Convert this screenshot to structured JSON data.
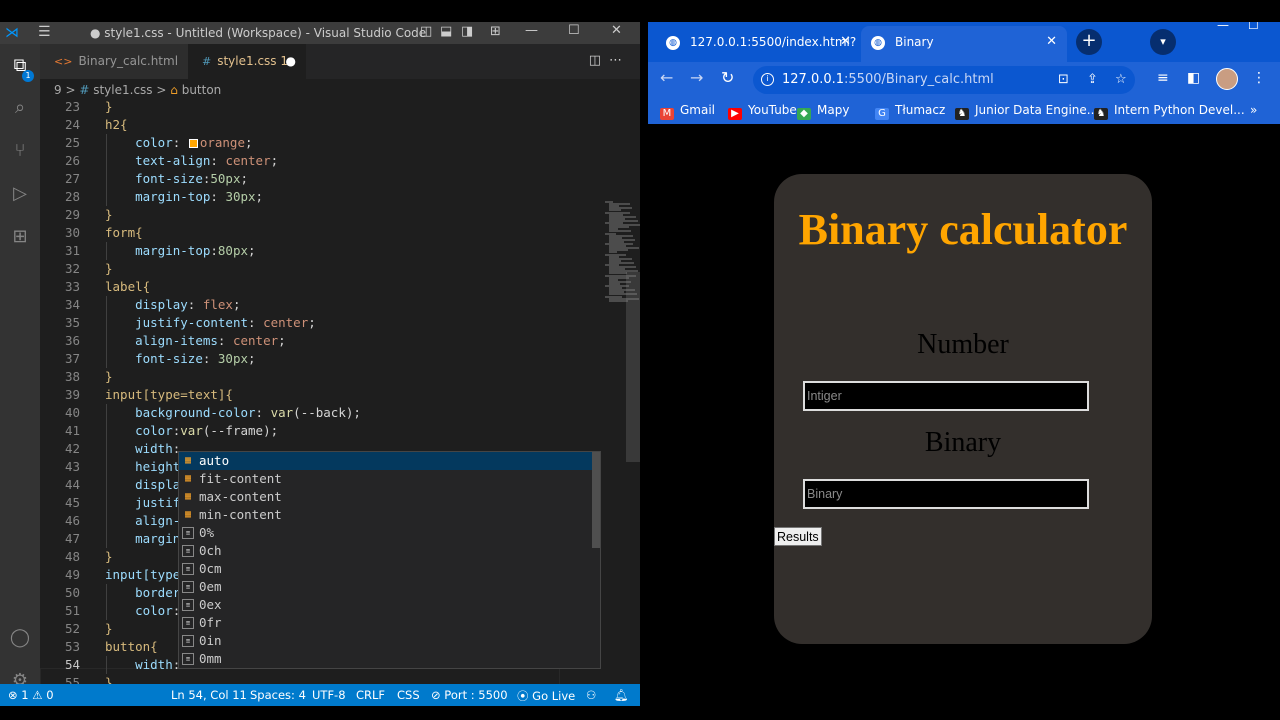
{
  "vscode": {
    "title": "● style1.css - Untitled (Workspace) - Visual Studio Code",
    "tabs": [
      {
        "label": "Binary_calc.html"
      },
      {
        "label": "style1.css 1"
      }
    ],
    "breadcrumb": {
      "prefix": "9 >",
      "file": "style1.css",
      "symbol": "button"
    },
    "status": {
      "problems": "⊗ 1 ⚠ 0",
      "position": "Ln 54, Col 11",
      "spaces": "Spaces: 4",
      "encoding": "UTF-8",
      "eol": "CRLF",
      "language": "CSS",
      "port": "⊘ Port : 5500",
      "golive": "⦿ Go Live"
    },
    "lines": [
      {
        "n": "23",
        "code": "}"
      },
      {
        "n": "24",
        "code": "h2{"
      },
      {
        "n": "25",
        "code": "    color: orange;"
      },
      {
        "n": "26",
        "code": "    text-align: center;"
      },
      {
        "n": "27",
        "code": "    font-size:50px;"
      },
      {
        "n": "28",
        "code": "    margin-top: 30px;"
      },
      {
        "n": "29",
        "code": "}"
      },
      {
        "n": "30",
        "code": "form{"
      },
      {
        "n": "31",
        "code": "    margin-top:80px;"
      },
      {
        "n": "32",
        "code": "}"
      },
      {
        "n": "33",
        "code": "label{"
      },
      {
        "n": "34",
        "code": "    display: flex;"
      },
      {
        "n": "35",
        "code": "    justify-content: center;"
      },
      {
        "n": "36",
        "code": "    align-items: center;"
      },
      {
        "n": "37",
        "code": "    font-size: 30px;"
      },
      {
        "n": "38",
        "code": "}"
      },
      {
        "n": "39",
        "code": "input[type=text]{"
      },
      {
        "n": "40",
        "code": "    background-color: var(--back);"
      },
      {
        "n": "41",
        "code": "    color:var(--frame);"
      },
      {
        "n": "42",
        "code": "    width:"
      },
      {
        "n": "43",
        "code": "    height"
      },
      {
        "n": "44",
        "code": "    displa"
      },
      {
        "n": "45",
        "code": "    justif"
      },
      {
        "n": "46",
        "code": "    align-"
      },
      {
        "n": "47",
        "code": "    margin"
      },
      {
        "n": "48",
        "code": "}"
      },
      {
        "n": "49",
        "code": "input[type"
      },
      {
        "n": "50",
        "code": "    border"
      },
      {
        "n": "51",
        "code": "    color:"
      },
      {
        "n": "52",
        "code": "}"
      },
      {
        "n": "53",
        "code": "button{"
      },
      {
        "n": "54",
        "code": "    width:"
      },
      {
        "n": "55",
        "code": "}"
      }
    ],
    "suggestions": [
      {
        "label": "auto",
        "kind": "keyword"
      },
      {
        "label": "fit-content",
        "kind": "keyword"
      },
      {
        "label": "max-content",
        "kind": "keyword"
      },
      {
        "label": "min-content",
        "kind": "keyword"
      },
      {
        "label": "0%",
        "kind": "unit"
      },
      {
        "label": "0ch",
        "kind": "unit"
      },
      {
        "label": "0cm",
        "kind": "unit"
      },
      {
        "label": "0em",
        "kind": "unit"
      },
      {
        "label": "0ex",
        "kind": "unit"
      },
      {
        "label": "0fr",
        "kind": "unit"
      },
      {
        "label": "0in",
        "kind": "unit"
      },
      {
        "label": "0mm",
        "kind": "unit"
      }
    ]
  },
  "chrome": {
    "tabs": [
      {
        "label": "127.0.0.1:5500/index.html?"
      },
      {
        "label": "Binary"
      }
    ],
    "url_host": "127.0.0.1",
    "url_path": ":5500/Binary_calc.html",
    "bookmarks": [
      {
        "label": "Gmail",
        "color": "#ea4335"
      },
      {
        "label": "YouTube",
        "color": "#ff0000"
      },
      {
        "label": "Mapy",
        "color": "#34a853"
      },
      {
        "label": "Tłumacz",
        "color": "#4285f4"
      },
      {
        "label": "Junior Data Engine...",
        "color": "#222222"
      },
      {
        "label": "Intern Python Devel...",
        "color": "#222222"
      }
    ],
    "page": {
      "heading": "Binary calculator",
      "label_number": "Number",
      "placeholder_number": "Intiger",
      "label_binary": "Binary",
      "placeholder_binary": "Binary",
      "button": "Results"
    }
  }
}
